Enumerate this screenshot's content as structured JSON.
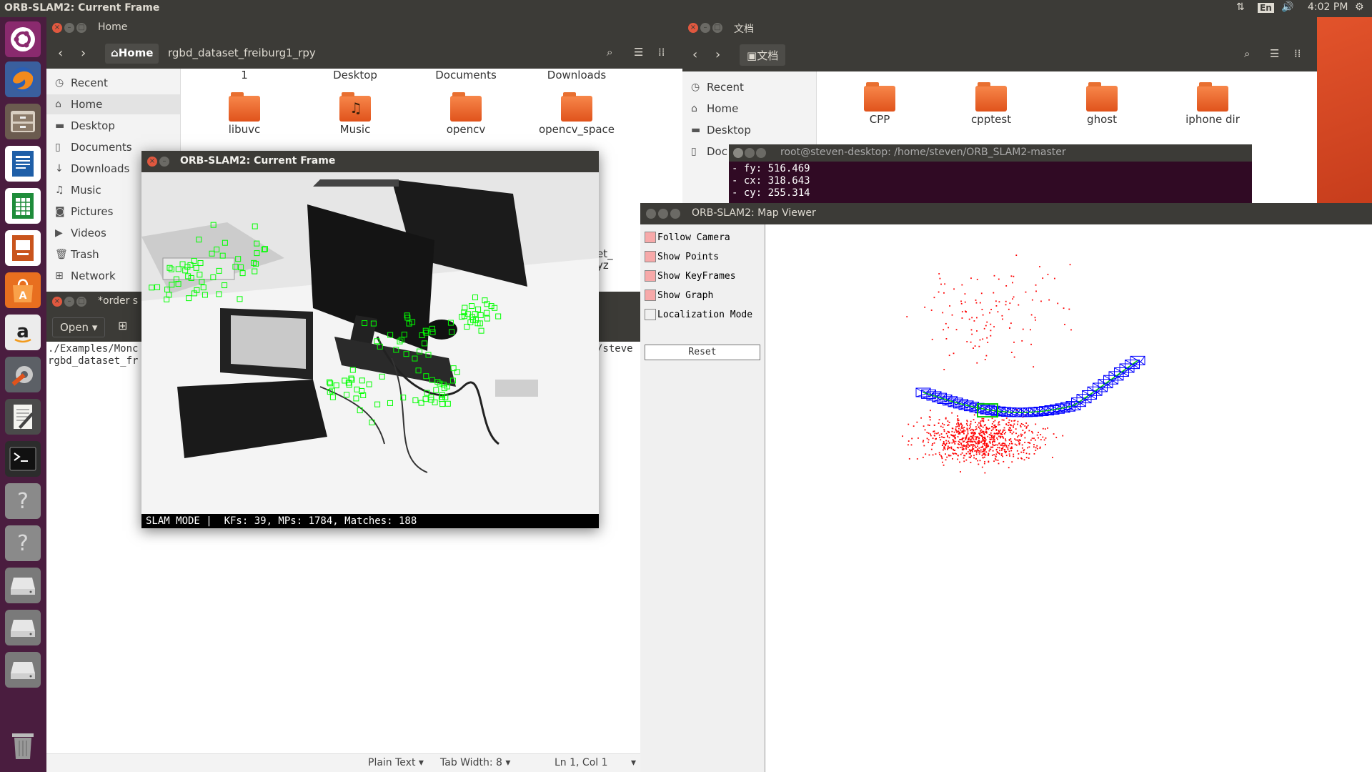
{
  "topbar": {
    "title": "ORB-SLAM2: Current Frame",
    "lang": "En",
    "time": "4:02 PM"
  },
  "launcher": {
    "items": [
      "ubuntu-dash-icon",
      "firefox-icon",
      "files-icon",
      "writer-icon",
      "calc-icon",
      "impress-icon",
      "software-center-icon",
      "amazon-icon",
      "system-settings-icon",
      "text-editor-icon",
      "terminal-icon",
      "unknown-app-icon",
      "unknown-app-icon",
      "drive-icon",
      "drive-icon",
      "drive-icon",
      "trash-icon"
    ]
  },
  "nautilus_home": {
    "title": "Home",
    "path_home": "Home",
    "path_current": "rgbd_dataset_freiburg1_rpy",
    "sidebar": [
      "Recent",
      "Home",
      "Desktop",
      "Documents",
      "Downloads",
      "Music",
      "Pictures",
      "Videos",
      "Trash",
      "Network"
    ],
    "top_labels": [
      "1",
      "Desktop",
      "Documents",
      "Downloads"
    ],
    "folders": [
      "libuvc",
      "Music",
      "opencv",
      "opencv_space"
    ],
    "hidden_tail": [
      "et_",
      "yz"
    ]
  },
  "nautilus_docs": {
    "title": "文档",
    "path_current": "文档",
    "sidebar": [
      "Recent",
      "Home",
      "Desktop",
      "Doc"
    ],
    "folders": [
      "CPP",
      "cpptest",
      "ghost",
      "iphone dir"
    ]
  },
  "gedit": {
    "title": "*order s",
    "open_label": "Open",
    "lines": [
      "./Examples/Monc",
      "rgbd_dataset_fr"
    ],
    "right_fragment": "/steve",
    "status": {
      "mode": "Plain Text",
      "tab": "Tab Width: 8",
      "pos": "Ln 1, Col 1"
    }
  },
  "terminal": {
    "title": "root@steven-desktop: /home/steven/ORB_SLAM2-master",
    "lines": [
      "- fy: 516.469",
      "- cx: 318.643",
      "- cy: 255.314"
    ]
  },
  "current_frame": {
    "title": "ORB-SLAM2: Current Frame",
    "status": "SLAM MODE |  KFs: 39, MPs: 1784, Matches: 188",
    "accent": "#00ff00"
  },
  "map_viewer": {
    "title": "ORB-SLAM2: Map Viewer",
    "options": [
      {
        "label": "Follow Camera",
        "checked": true
      },
      {
        "label": "Show Points",
        "checked": true
      },
      {
        "label": "Show KeyFrames",
        "checked": true
      },
      {
        "label": "Show Graph",
        "checked": true
      },
      {
        "label": "Localization Mode",
        "checked": false
      }
    ],
    "reset_label": "Reset",
    "colors": {
      "points": "#ff0000",
      "keyframes": "#0000ff",
      "graph": "#00cc00"
    }
  }
}
